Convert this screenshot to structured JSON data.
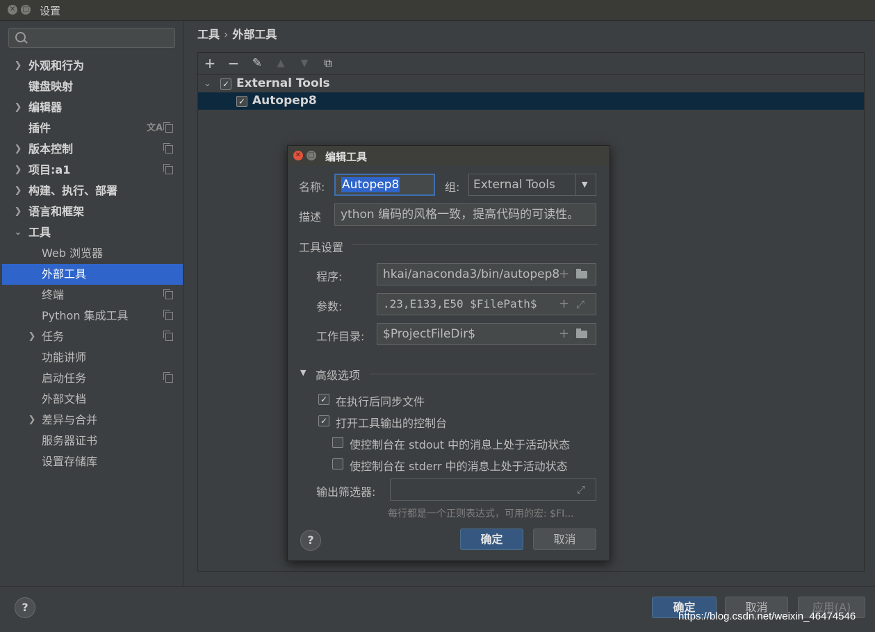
{
  "window": {
    "title": "设置"
  },
  "sidebar": {
    "search_placeholder": "",
    "items": [
      {
        "label": "外观和行为",
        "expandable": true,
        "bold": true
      },
      {
        "label": "键盘映射",
        "expandable": false,
        "bold": true
      },
      {
        "label": "编辑器",
        "expandable": true,
        "bold": true
      },
      {
        "label": "插件",
        "expandable": false,
        "bold": true
      },
      {
        "label": "版本控制",
        "expandable": true,
        "bold": true
      },
      {
        "label": "项目:a1",
        "expandable": true,
        "bold": true
      },
      {
        "label": "构建、执行、部署",
        "expandable": true,
        "bold": true
      },
      {
        "label": "语言和框架",
        "expandable": true,
        "bold": true
      },
      {
        "label": "工具",
        "expanded": true,
        "bold": true
      },
      {
        "label": "Web 浏览器"
      },
      {
        "label": "外部工具",
        "selected": true
      },
      {
        "label": "终端"
      },
      {
        "label": "Python 集成工具"
      },
      {
        "label": "任务",
        "expandable": true
      },
      {
        "label": "功能讲师"
      },
      {
        "label": "启动任务"
      },
      {
        "label": "外部文档"
      },
      {
        "label": "差异与合并",
        "expandable": true
      },
      {
        "label": "服务器证书"
      },
      {
        "label": "设置存储库"
      }
    ]
  },
  "breadcrumb": {
    "parent": "工具",
    "separator": "›",
    "current": "外部工具"
  },
  "tree": {
    "group": {
      "label": "External Tools",
      "checked": true
    },
    "tool": {
      "label": "Autopep8",
      "checked": true
    }
  },
  "dialog": {
    "title": "编辑工具",
    "name_label": "名称:",
    "name_value": "Autopep8",
    "group_label": "组:",
    "group_value": "External Tools",
    "desc_label": "描述",
    "desc_value": "ython 编码的风格一致，提高代码的可读性。",
    "tool_settings_title": "工具设置",
    "program_label": "程序:",
    "program_value": "hkai/anaconda3/bin/autopep8",
    "args_label": "参数:",
    "args_value": ".23,E133,E50 $FilePath$",
    "workdir_label": "工作目录:",
    "workdir_value": "$ProjectFileDir$",
    "advanced_title": "高级选项",
    "opt_sync": {
      "label": "在执行后同步文件",
      "checked": true
    },
    "opt_console": {
      "label": "打开工具输出的控制台",
      "checked": true
    },
    "opt_stdout": {
      "label": "使控制台在 stdout 中的消息上处于活动状态",
      "checked": false
    },
    "opt_stderr": {
      "label": "使控制台在 stderr 中的消息上处于活动状态",
      "checked": false
    },
    "filter_label": "输出筛选器:",
    "filter_value": "",
    "filter_hint": "每行都是一个正则表达式，可用的宏: $FI...",
    "ok_label": "确定",
    "cancel_label": "取消",
    "help_label": "?"
  },
  "footer": {
    "help_label": "?",
    "ok_label": "确定",
    "cancel_label": "取消",
    "apply_label": "应用(A)"
  },
  "watermark": "https://blog.csdn.net/weixin_46474546",
  "colors": {
    "selection": "#2f65ca",
    "tree_selection": "#0d293e",
    "primary_button": "#365880",
    "background": "#3c3f41"
  }
}
